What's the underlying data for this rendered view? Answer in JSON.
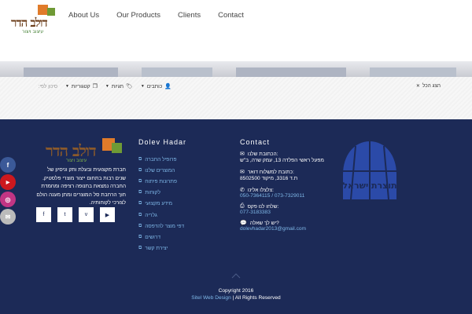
{
  "header": {
    "logo": {
      "word": "דולב הדר",
      "tagline": "עיצוב ויצור"
    },
    "nav": [
      "About Us",
      "Our Products",
      "Clients",
      "Contact"
    ]
  },
  "filterbar": {
    "filters": [
      {
        "icon": "user-icon",
        "label": "כותבים"
      },
      {
        "icon": "tag-icon",
        "label": "תגיות"
      },
      {
        "icon": "copy-icon",
        "label": "קטגוריות"
      }
    ],
    "sort_label": "סינון לפי:",
    "show_all": "הצג הכל"
  },
  "footer": {
    "logo": {
      "word": "דולב הדר",
      "tagline": "עיצוב ויצור"
    },
    "about_text": "חברת מקצועית ובעלת ותק וניסיון של שנים רבות בתחום ייצור מוצרי פלסטיק. החברה נמצאת בתנופה רציפה ומחמדת חוך הרחבת סל המוצרים ומתן מענה הולם לצורכי לקוחותיה.",
    "social_buttons": [
      {
        "icon": "facebook-icon",
        "glyph": "f"
      },
      {
        "icon": "twitter-icon",
        "glyph": "t"
      },
      {
        "icon": "vimeo-icon",
        "glyph": "v"
      },
      {
        "icon": "youtube-icon",
        "glyph": "▶"
      }
    ],
    "links_title": "Dolev Hadar",
    "links": [
      "פרופיל החברה",
      "המוצרים שלנו",
      "פתרונות פיתוח",
      "לקוחות",
      "מידע מקצועי",
      "גלריה",
      "דפי מוצר להדפסה",
      "דרושים",
      "יצירת קשר"
    ],
    "contact_title": "Contact",
    "contact": {
      "address_label": "הכתובת שלנו:",
      "address_value": "מפעל ראשי הפלדה 13, עמק שרה, ב\"ש",
      "mail_label": "כתובת למשלוח דואר:",
      "mail_value": "ת.ד 3316, מיקוד 8502500",
      "phone_label": "צלצלו אלינו:",
      "phone_value": "050-7364115 / 073-7329011",
      "fax_label": "שלחו לנו פקס:",
      "fax_value": "077-3183383",
      "question_label": "יש לך שאלה?",
      "email_value": "dolevhadar2013@gmail.com"
    },
    "emblem_text": "תוצרת ישראל",
    "copyright_line1": "Copyright 2016",
    "copyright_brand": "Sitel Web Design",
    "copyright_rest": " | All Rights Reserved"
  },
  "side_social": [
    {
      "icon": "facebook-icon",
      "glyph": "f",
      "color": "#3b5998"
    },
    {
      "icon": "youtube-icon",
      "glyph": "▶",
      "color": "#cc181e"
    },
    {
      "icon": "instagram-icon",
      "glyph": "◎",
      "color": "#c13584"
    },
    {
      "icon": "mail-icon",
      "glyph": "✉",
      "color": "#bbbbbb"
    }
  ],
  "colors": {
    "footer_bg": "#1c2a57",
    "link": "#7fb8e8",
    "logo_brown": "#8b5a2b",
    "logo_green": "#7fb24a"
  }
}
